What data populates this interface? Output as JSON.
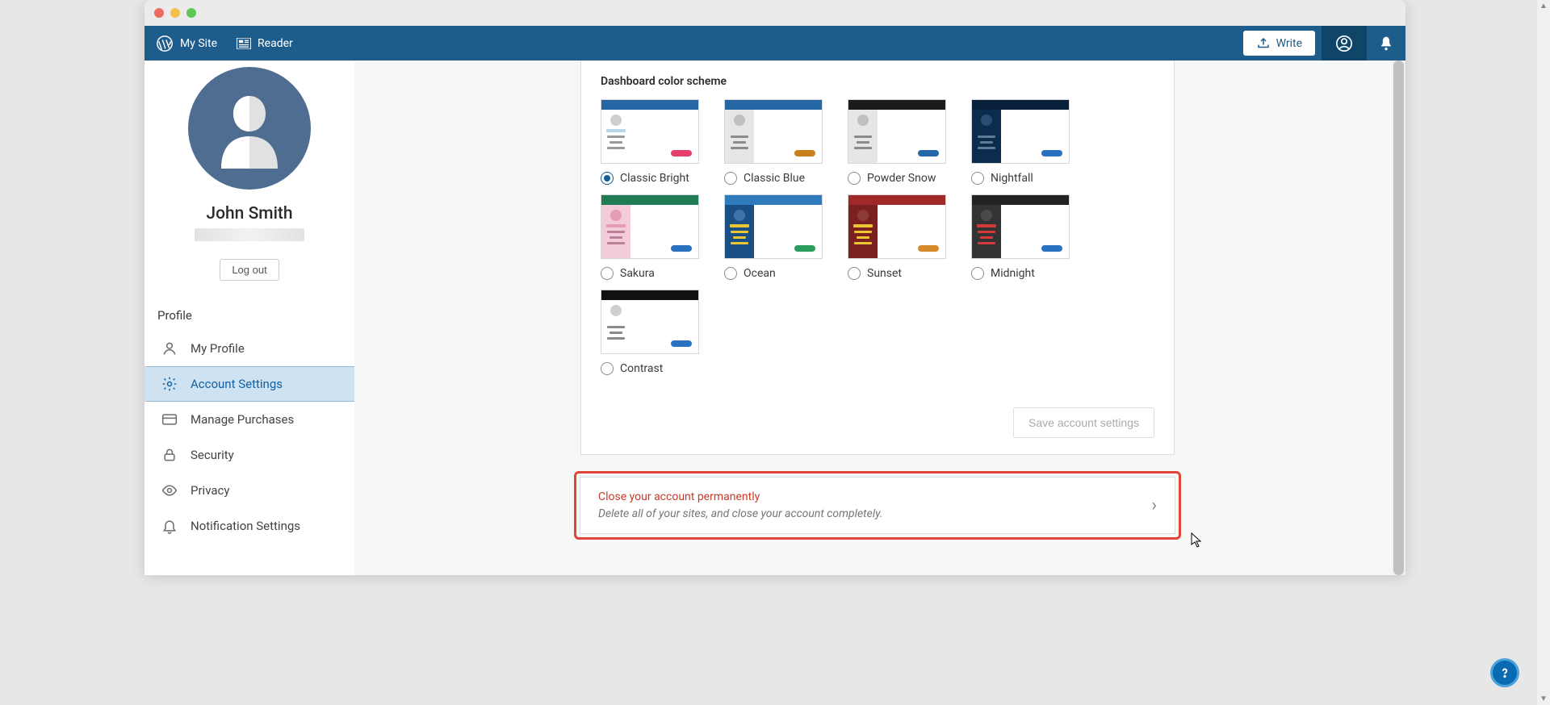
{
  "topbar": {
    "my_site": "My Site",
    "reader": "Reader",
    "write": "Write"
  },
  "sidebar": {
    "user_name": "John Smith",
    "logout": "Log out",
    "heading": "Profile",
    "items": [
      {
        "label": "My Profile"
      },
      {
        "label": "Account Settings"
      },
      {
        "label": "Manage Purchases"
      },
      {
        "label": "Security"
      },
      {
        "label": "Privacy"
      },
      {
        "label": "Notification Settings"
      }
    ]
  },
  "section_title": "Dashboard color scheme",
  "schemes": [
    {
      "label": "Classic Bright",
      "top": "#2567a5",
      "side": "#ffffff",
      "circ": "#cfcfcf",
      "line": "#9a9a9a",
      "pill": "#e3416c",
      "accent": "#b9d5ea"
    },
    {
      "label": "Classic Blue",
      "top": "#2567a5",
      "side": "#e6e6e6",
      "circ": "#bfbfbf",
      "line": "#8b8b8b",
      "pill": "#c97f1c",
      "accent": "#e6e6e6"
    },
    {
      "label": "Powder Snow",
      "top": "#1b1b1b",
      "side": "#e6e6e6",
      "circ": "#bfbfbf",
      "line": "#8b8b8b",
      "pill": "#2567a5",
      "accent": "#e6e6e6"
    },
    {
      "label": "Nightfall",
      "top": "#09203a",
      "side": "#0b2c4d",
      "circ": "#2a4e72",
      "line": "#5c7c9a",
      "pill": "#2a72c0",
      "accent": "#0b2c4d"
    },
    {
      "label": "Sakura",
      "top": "#1f7c55",
      "side": "#f4cbd8",
      "circ": "#e49db4",
      "line": "#b98199",
      "pill": "#2a72c0",
      "accent": "#e49db4"
    },
    {
      "label": "Ocean",
      "top": "#2f7bbd",
      "side": "#1a4f84",
      "circ": "#3b74aa",
      "line": "#eac635",
      "pill": "#2a9d5c",
      "accent": "#eac635"
    },
    {
      "label": "Sunset",
      "top": "#a02828",
      "side": "#7c1f1f",
      "circ": "#8e3a3a",
      "line": "#eac635",
      "pill": "#d68a2a",
      "accent": "#eac635"
    },
    {
      "label": "Midnight",
      "top": "#222222",
      "side": "#333333",
      "circ": "#4a4a4a",
      "line": "#d43a3a",
      "pill": "#2a72c0",
      "accent": "#d43a3a"
    },
    {
      "label": "Contrast",
      "top": "#111111",
      "side": "#ffffff",
      "circ": "#cfcfcf",
      "line": "#8b8b8b",
      "pill": "#2a72c0",
      "accent": "#ffffff"
    }
  ],
  "selected_scheme": "Classic Bright",
  "save_button": "Save account settings",
  "danger": {
    "title": "Close your account permanently",
    "subtitle": "Delete all of your sites, and close your account completely."
  }
}
